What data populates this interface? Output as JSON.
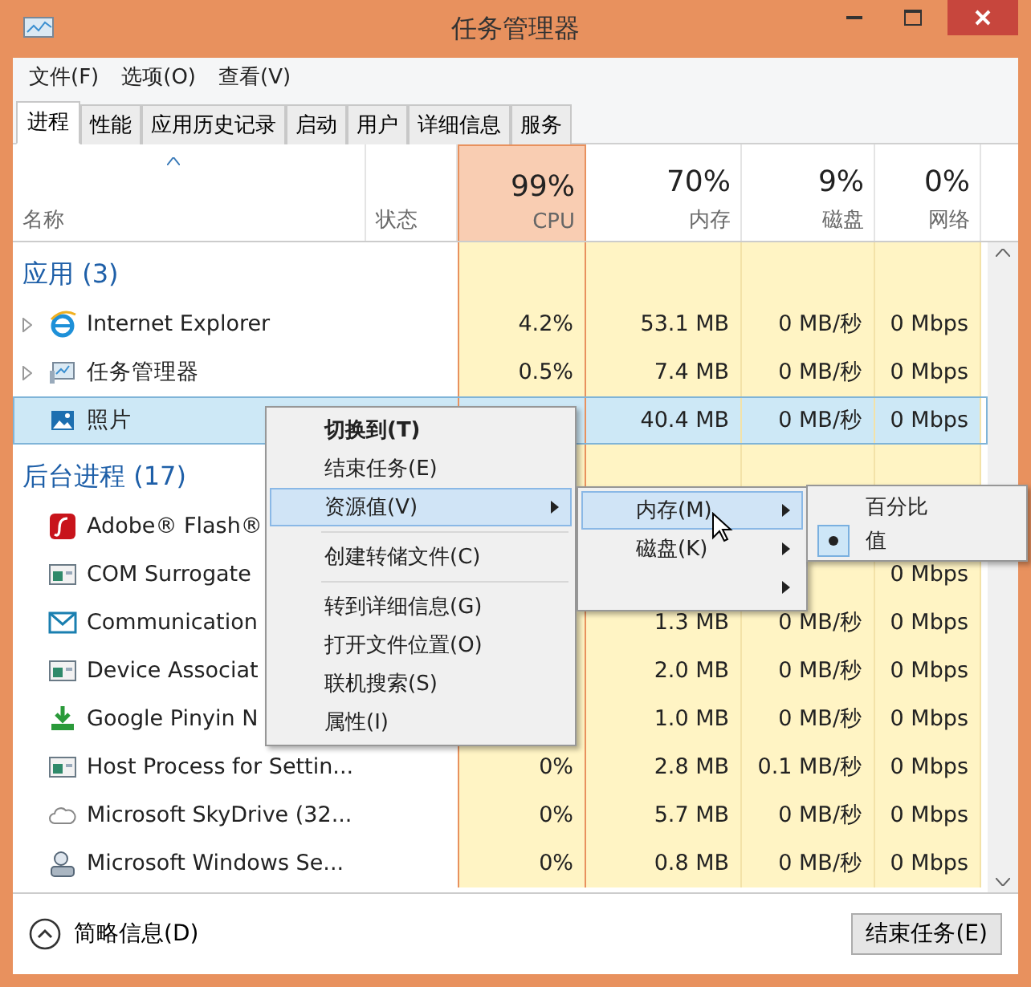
{
  "window": {
    "title": "任务管理器"
  },
  "menu_bar": [
    "文件(F)",
    "选项(O)",
    "查看(V)"
  ],
  "tabs": [
    {
      "label": "进程",
      "selected": true
    },
    {
      "label": "性能",
      "selected": false
    },
    {
      "label": "应用历史记录",
      "selected": false
    },
    {
      "label": "启动",
      "selected": false
    },
    {
      "label": "用户",
      "selected": false
    },
    {
      "label": "详细信息",
      "selected": false
    },
    {
      "label": "服务",
      "selected": false
    }
  ],
  "columns": [
    {
      "kind": "name",
      "label": "名称"
    },
    {
      "kind": "status",
      "label": "状态"
    },
    {
      "kind": "metric",
      "percent": "99%",
      "label": "CPU",
      "selected": true
    },
    {
      "kind": "metric",
      "percent": "70%",
      "label": "内存",
      "selected": false
    },
    {
      "kind": "metric",
      "percent": "9%",
      "label": "磁盘",
      "selected": false
    },
    {
      "kind": "metric",
      "percent": "0%",
      "label": "网络",
      "selected": false
    }
  ],
  "groups": [
    {
      "title": "应用 (3)",
      "rows": [
        {
          "kind": "browser",
          "name": "Internet Explorer",
          "expandable": true,
          "selected": false,
          "cells": [
            "4.2%",
            "53.1 MB",
            "0 MB/秒",
            "0 Mbps"
          ]
        },
        {
          "kind": "monitor",
          "name": "任务管理器",
          "expandable": true,
          "selected": false,
          "cells": [
            "0.5%",
            "7.4 MB",
            "0 MB/秒",
            "0 Mbps"
          ]
        },
        {
          "kind": "picture",
          "name": "照片",
          "expandable": false,
          "selected": true,
          "cells": [
            null,
            "40.4 MB",
            "0 MB/秒",
            "0 Mbps"
          ]
        }
      ]
    },
    {
      "title": "后台进程 (17)",
      "rows": [
        {
          "kind": "flash",
          "name": "Adobe® Flash®",
          "expandable": false,
          "selected": false,
          "cells": [
            null,
            null,
            null,
            null
          ]
        },
        {
          "kind": "window",
          "name": "COM Surrogate",
          "expandable": false,
          "selected": false,
          "cells": [
            null,
            null,
            null,
            "0 Mbps"
          ]
        },
        {
          "kind": "mail",
          "name": "Communication",
          "expandable": false,
          "selected": false,
          "cells": [
            null,
            "1.3 MB",
            "0 MB/秒",
            "0 Mbps"
          ]
        },
        {
          "kind": "window",
          "name": "Device Associat",
          "expandable": false,
          "selected": false,
          "cells": [
            null,
            "2.0 MB",
            "0 MB/秒",
            "0 Mbps"
          ]
        },
        {
          "kind": "download",
          "name": "Google Pinyin N",
          "expandable": false,
          "selected": false,
          "cells": [
            null,
            "1.0 MB",
            "0 MB/秒",
            "0 Mbps"
          ]
        },
        {
          "kind": "window",
          "name": "Host Process for Settin...",
          "expandable": false,
          "selected": false,
          "cells": [
            "0%",
            "2.8 MB",
            "0.1 MB/秒",
            "0 Mbps"
          ]
        },
        {
          "kind": "cloud",
          "name": "Microsoft SkyDrive (32...",
          "expandable": false,
          "selected": false,
          "cells": [
            "0%",
            "5.7 MB",
            "0 MB/秒",
            "0 Mbps"
          ]
        },
        {
          "kind": "user",
          "name": "Microsoft Windows Se...",
          "expandable": false,
          "selected": false,
          "cells": [
            "0%",
            "0.8 MB",
            "0 MB/秒",
            "0 Mbps"
          ]
        }
      ]
    }
  ],
  "context_menu": [
    {
      "kind": "default",
      "label": "切换到(T)",
      "selected": false
    },
    {
      "kind": "item",
      "label": "结束任务(E)",
      "selected": false
    },
    {
      "kind": "submenu",
      "label": "资源值(V)",
      "selected": true
    },
    {
      "kind": "separator"
    },
    {
      "kind": "item",
      "label": "创建转储文件(C)",
      "selected": false
    },
    {
      "kind": "separator"
    },
    {
      "kind": "item",
      "label": "转到详细信息(G)",
      "selected": false
    },
    {
      "kind": "item",
      "label": "打开文件位置(O)",
      "selected": false
    },
    {
      "kind": "item",
      "label": "联机搜索(S)",
      "selected": false
    },
    {
      "kind": "item",
      "label": "属性(I)",
      "selected": false
    }
  ],
  "submenu": [
    {
      "label": "内存(M)",
      "selected": true
    },
    {
      "label": "磁盘(K)",
      "selected": false
    },
    {
      "selected": false
    }
  ],
  "value_menu": [
    {
      "label": "百分比",
      "checked": false
    },
    {
      "label": "值",
      "checked": true
    }
  ],
  "footer": {
    "details": "简略信息(D)",
    "button": "结束任务(E)"
  }
}
